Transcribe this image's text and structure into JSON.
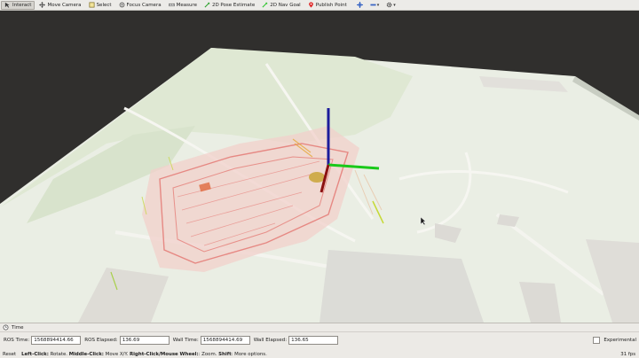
{
  "toolbar": {
    "tools": [
      {
        "label": "Interact",
        "icon": "interact-icon",
        "active": true
      },
      {
        "label": "Move Camera",
        "icon": "move-camera-icon"
      },
      {
        "label": "Select",
        "icon": "select-icon"
      },
      {
        "label": "Focus Camera",
        "icon": "focus-camera-icon"
      },
      {
        "label": "Measure",
        "icon": "measure-icon"
      },
      {
        "label": "2D Pose Estimate",
        "icon": "pose-estimate-icon"
      },
      {
        "label": "2D Nav Goal",
        "icon": "nav-goal-icon"
      },
      {
        "label": "Publish Point",
        "icon": "publish-point-icon"
      }
    ]
  },
  "time_panel": {
    "title": "Time",
    "ros_time_label": "ROS Time:",
    "ros_time_value": "1568894414.66",
    "ros_elapsed_label": "ROS Elapsed:",
    "ros_elapsed_value": "136.69",
    "wall_time_label": "Wall Time:",
    "wall_time_value": "1568894414.69",
    "wall_elapsed_label": "Wall Elapsed:",
    "wall_elapsed_value": "136.65",
    "experimental_label": "Experimental"
  },
  "status_bar": {
    "reset_label": "Reset",
    "hint_bold_1": "Left-Click:",
    "hint_1": " Rotate. ",
    "hint_bold_2": "Middle-Click:",
    "hint_2": " Move X/Y. ",
    "hint_bold_3": "Right-Click/Mouse Wheel:",
    "hint_3": ": Zoom. ",
    "hint_bold_4": "Shift",
    "hint_4": ": More options.",
    "fps": "31 fps"
  },
  "colors": {
    "background": "#302f2d",
    "axis_x": "#8b1111",
    "axis_y": "#19c919",
    "axis_z": "#1c1c9b",
    "point_cloud": "#e0534e"
  }
}
